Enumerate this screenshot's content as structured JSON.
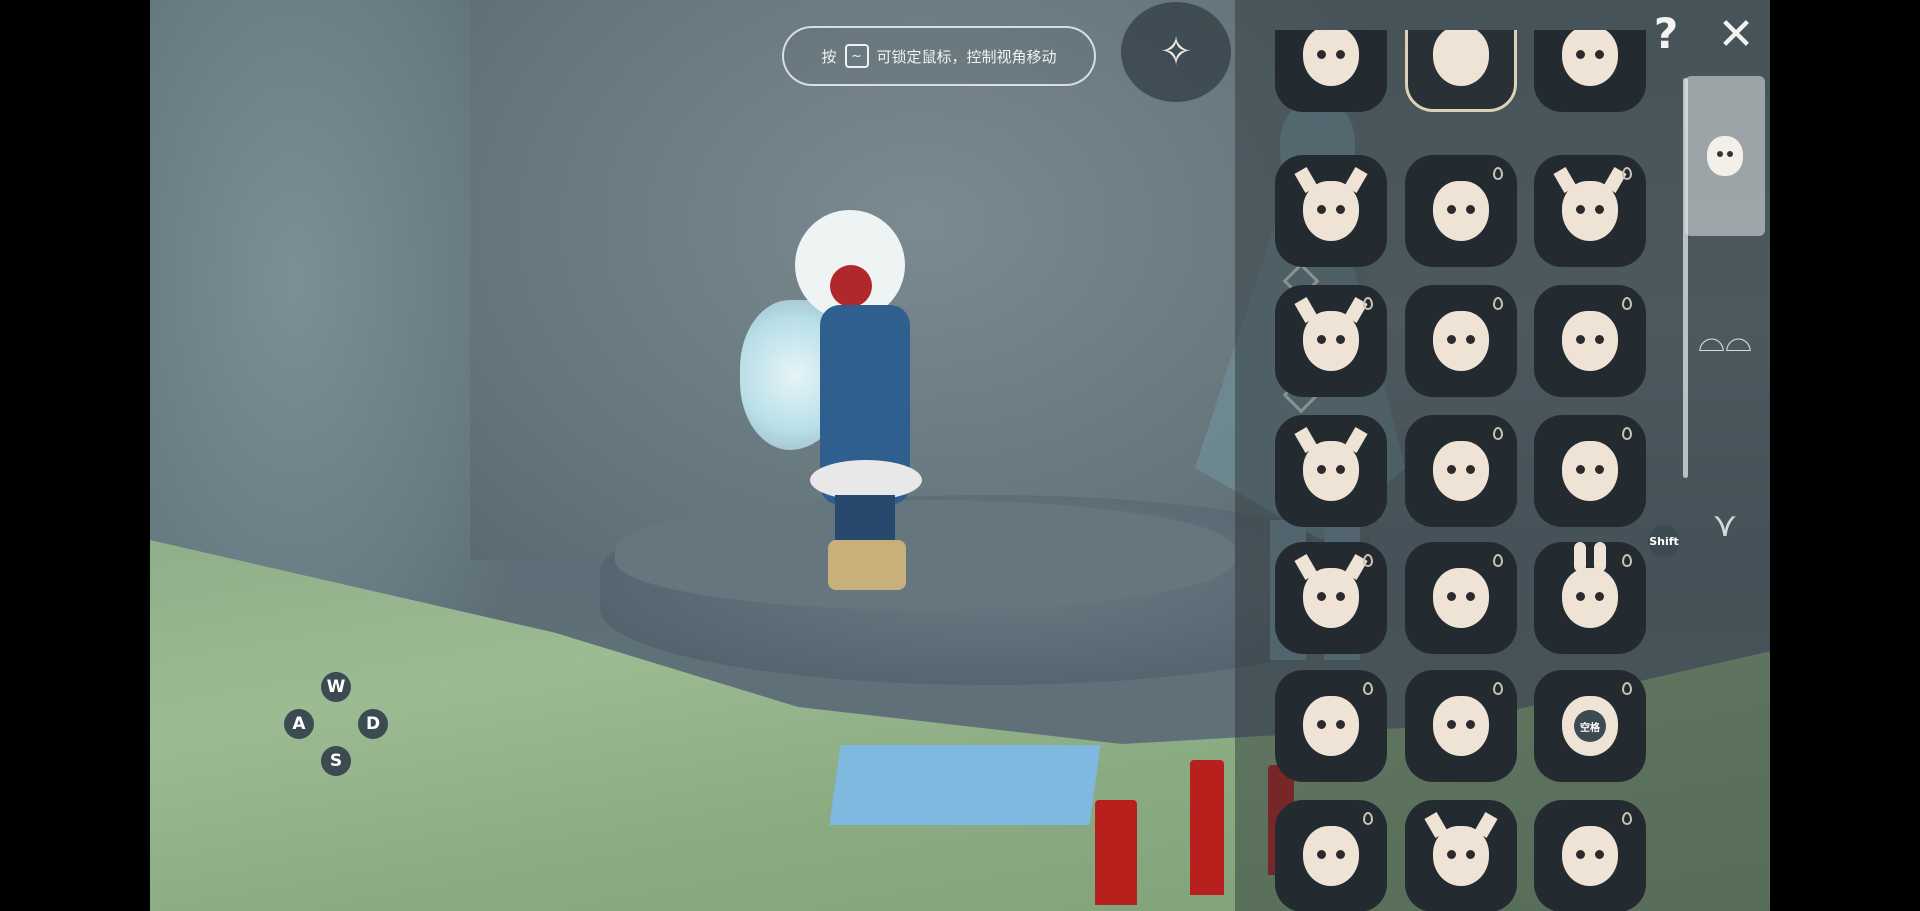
{
  "hud": {
    "hint_prefix": "按",
    "hint_key": "~",
    "hint_text": "可锁定鼠标，控制视角移动",
    "emote_icon": "emote-sparkle-icon"
  },
  "movement_keys": {
    "up": "W",
    "left": "A",
    "right": "D",
    "down": "S"
  },
  "closet": {
    "help_label": "?",
    "close_label": "✕",
    "shift_key": "Shift",
    "space_key": "空格",
    "tabs": [
      {
        "name": "mask",
        "icon": "mask-icon",
        "active": true
      },
      {
        "name": "accessory",
        "icon": "glasses-icon",
        "active": false
      },
      {
        "name": "necklace",
        "icon": "necklace-icon",
        "active": false
      }
    ],
    "masks": [
      {
        "style": "round",
        "selected": false,
        "drop": false
      },
      {
        "style": "sleep",
        "selected": true,
        "drop": false
      },
      {
        "style": "stitched",
        "selected": false,
        "drop": false
      },
      {
        "style": "horned",
        "selected": false,
        "drop": false
      },
      {
        "style": "diamond",
        "selected": false,
        "drop": true
      },
      {
        "style": "horned",
        "selected": false,
        "drop": true
      },
      {
        "style": "horned",
        "selected": false,
        "drop": true
      },
      {
        "style": "round",
        "selected": false,
        "drop": true
      },
      {
        "style": "round",
        "selected": false,
        "drop": true
      },
      {
        "style": "horned",
        "selected": false,
        "drop": false
      },
      {
        "style": "round",
        "selected": false,
        "drop": true
      },
      {
        "style": "round",
        "selected": false,
        "drop": true
      },
      {
        "style": "horned",
        "selected": false,
        "drop": true
      },
      {
        "style": "round",
        "selected": false,
        "drop": true
      },
      {
        "style": "ears",
        "selected": false,
        "drop": true
      },
      {
        "style": "round",
        "selected": false,
        "drop": true
      },
      {
        "style": "round",
        "selected": false,
        "drop": true
      },
      {
        "style": "round",
        "selected": false,
        "drop": true
      },
      {
        "style": "round",
        "selected": false,
        "drop": true
      },
      {
        "style": "horned",
        "selected": false,
        "drop": false
      },
      {
        "style": "round",
        "selected": false,
        "drop": true
      }
    ]
  }
}
